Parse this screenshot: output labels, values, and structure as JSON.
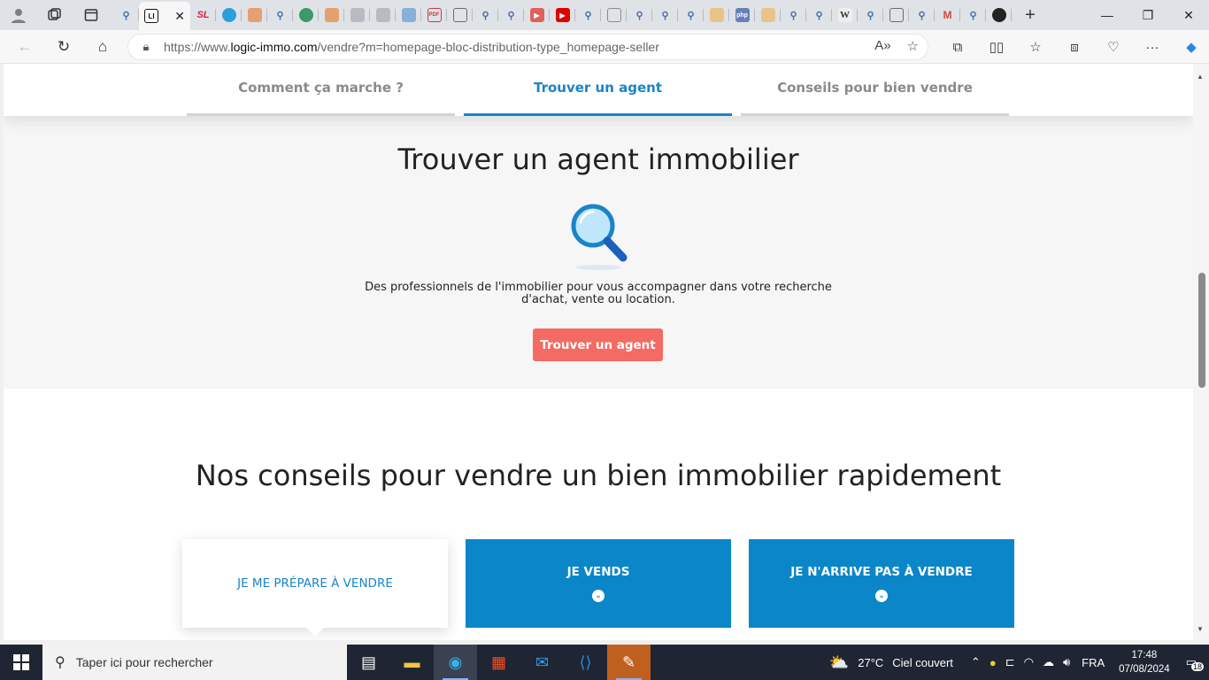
{
  "browser": {
    "active_tab_favicon": "LI",
    "address_url_prefix": "https://www.",
    "address_url_domain": "logic-immo.com",
    "address_url_path": "/vendre?m=homepage-bloc-distribution-type_homepage-seller"
  },
  "tabs": [
    {
      "icon": "search-icon",
      "color": "#4a6fa5"
    },
    {
      "icon": "logic-immo-favicon",
      "color": "#111111",
      "active": true
    },
    {
      "icon": "sl-favicon",
      "color": "#d4213d"
    },
    {
      "icon": "edge-favicon",
      "color": "#2b9fd8"
    },
    {
      "icon": "orange-square-favicon",
      "color": "#e5a070"
    },
    {
      "icon": "search-icon",
      "color": "#4a6fa5"
    },
    {
      "icon": "globe-favicon",
      "color": "#3a9a6a"
    },
    {
      "icon": "orange-square-favicon",
      "color": "#e5a070"
    },
    {
      "icon": "document-favicon",
      "color": "#9aa0a8"
    },
    {
      "icon": "document-favicon",
      "color": "#9aa0a8"
    },
    {
      "icon": "monitor-favicon",
      "color": "#5a8ac8"
    },
    {
      "icon": "pdf-favicon",
      "color": "#c83a3a"
    },
    {
      "icon": "calendar-favicon",
      "color": "#6a6a6a"
    },
    {
      "icon": "search-icon",
      "color": "#4a6fa5"
    },
    {
      "icon": "search-icon",
      "color": "#4a6fa5"
    },
    {
      "icon": "youtube-favicon",
      "color": "#e0605a"
    },
    {
      "icon": "youtube-favicon",
      "color": "#e00000"
    },
    {
      "icon": "search-icon",
      "color": "#4a6fa5"
    },
    {
      "icon": "page-favicon",
      "color": "#8a8a8a"
    },
    {
      "icon": "search-icon",
      "color": "#4a6fa5"
    },
    {
      "icon": "search-icon",
      "color": "#4a6fa5"
    },
    {
      "icon": "search-icon",
      "color": "#4a6fa5"
    },
    {
      "icon": "phpmyadmin-favicon",
      "color": "#d9a050"
    },
    {
      "icon": "php-favicon",
      "color": "#6a7fb8"
    },
    {
      "icon": "phpmyadmin-favicon",
      "color": "#d9a050"
    },
    {
      "icon": "search-icon",
      "color": "#4a6fa5"
    },
    {
      "icon": "search-icon",
      "color": "#4a6fa5"
    },
    {
      "icon": "wikipedia-favicon",
      "color": "#555555"
    },
    {
      "icon": "search-icon",
      "color": "#4a6fa5"
    },
    {
      "icon": "translate-favicon",
      "color": "#6a6a6a"
    },
    {
      "icon": "search-icon",
      "color": "#4a6fa5"
    },
    {
      "icon": "gmail-favicon",
      "color": "#d44638"
    },
    {
      "icon": "search-icon",
      "color": "#4a6fa5"
    },
    {
      "icon": "github-favicon",
      "color": "#222222"
    }
  ],
  "subnav": {
    "tabs": [
      {
        "label": "Comment ça marche ?",
        "active": false
      },
      {
        "label": "Trouver un agent",
        "active": true
      },
      {
        "label": "Conseils pour bien vendre",
        "active": false
      }
    ]
  },
  "agent_section": {
    "title": "Trouver un agent immobilier",
    "description_line1": "Des professionnels de l'immobilier pour vous accompagner dans votre recherche",
    "description_line2": "d'achat, vente ou location.",
    "button_label": "Trouver un agent",
    "button_color": "#f46b64"
  },
  "tips_section": {
    "title": "Nos conseils pour vendre un bien immobilier rapidement",
    "cards": [
      {
        "label": "JE ME PRÉPARE À VENDRE",
        "selected": true
      },
      {
        "label": "JE VENDS",
        "selected": false
      },
      {
        "label": "JE N'ARRIVE PAS À VENDRE",
        "selected": false
      }
    ],
    "accent_color": "#0b86c9"
  },
  "taskbar": {
    "search_placeholder": "Taper ici pour rechercher",
    "weather_temp": "27°C",
    "weather_desc": "Ciel couvert",
    "language": "FRA",
    "time": "17:48",
    "date": "07/08/2024",
    "notification_count": "18"
  }
}
